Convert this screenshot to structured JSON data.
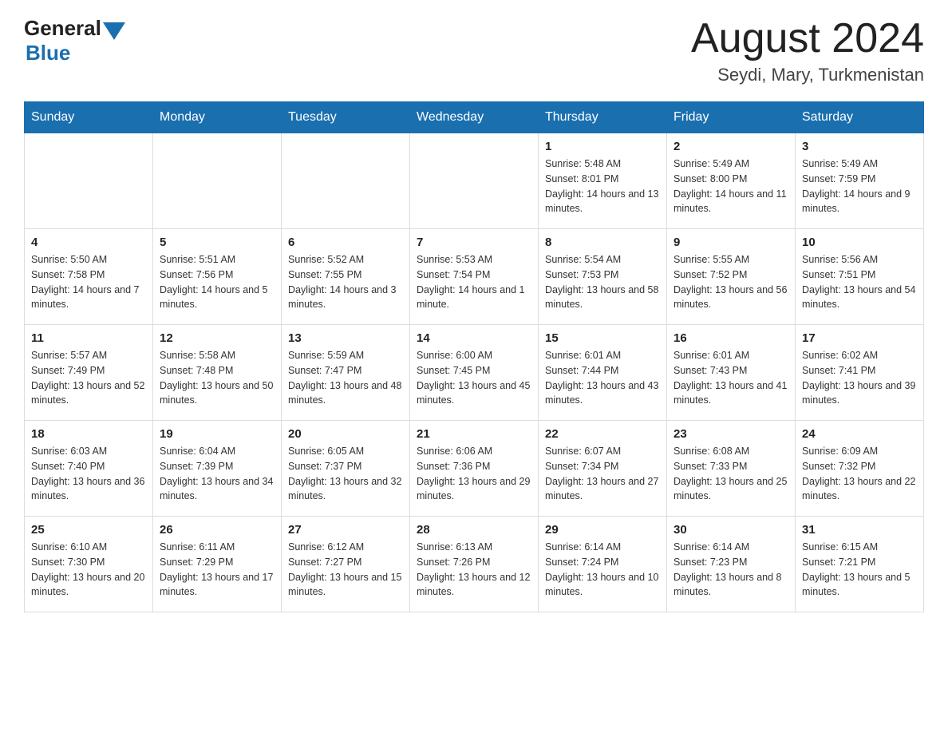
{
  "header": {
    "logo_general": "General",
    "logo_blue": "Blue",
    "title": "August 2024",
    "subtitle": "Seydi, Mary, Turkmenistan"
  },
  "weekdays": [
    "Sunday",
    "Monday",
    "Tuesday",
    "Wednesday",
    "Thursday",
    "Friday",
    "Saturday"
  ],
  "weeks": [
    [
      {
        "day": "",
        "info": ""
      },
      {
        "day": "",
        "info": ""
      },
      {
        "day": "",
        "info": ""
      },
      {
        "day": "",
        "info": ""
      },
      {
        "day": "1",
        "info": "Sunrise: 5:48 AM\nSunset: 8:01 PM\nDaylight: 14 hours and 13 minutes."
      },
      {
        "day": "2",
        "info": "Sunrise: 5:49 AM\nSunset: 8:00 PM\nDaylight: 14 hours and 11 minutes."
      },
      {
        "day": "3",
        "info": "Sunrise: 5:49 AM\nSunset: 7:59 PM\nDaylight: 14 hours and 9 minutes."
      }
    ],
    [
      {
        "day": "4",
        "info": "Sunrise: 5:50 AM\nSunset: 7:58 PM\nDaylight: 14 hours and 7 minutes."
      },
      {
        "day": "5",
        "info": "Sunrise: 5:51 AM\nSunset: 7:56 PM\nDaylight: 14 hours and 5 minutes."
      },
      {
        "day": "6",
        "info": "Sunrise: 5:52 AM\nSunset: 7:55 PM\nDaylight: 14 hours and 3 minutes."
      },
      {
        "day": "7",
        "info": "Sunrise: 5:53 AM\nSunset: 7:54 PM\nDaylight: 14 hours and 1 minute."
      },
      {
        "day": "8",
        "info": "Sunrise: 5:54 AM\nSunset: 7:53 PM\nDaylight: 13 hours and 58 minutes."
      },
      {
        "day": "9",
        "info": "Sunrise: 5:55 AM\nSunset: 7:52 PM\nDaylight: 13 hours and 56 minutes."
      },
      {
        "day": "10",
        "info": "Sunrise: 5:56 AM\nSunset: 7:51 PM\nDaylight: 13 hours and 54 minutes."
      }
    ],
    [
      {
        "day": "11",
        "info": "Sunrise: 5:57 AM\nSunset: 7:49 PM\nDaylight: 13 hours and 52 minutes."
      },
      {
        "day": "12",
        "info": "Sunrise: 5:58 AM\nSunset: 7:48 PM\nDaylight: 13 hours and 50 minutes."
      },
      {
        "day": "13",
        "info": "Sunrise: 5:59 AM\nSunset: 7:47 PM\nDaylight: 13 hours and 48 minutes."
      },
      {
        "day": "14",
        "info": "Sunrise: 6:00 AM\nSunset: 7:45 PM\nDaylight: 13 hours and 45 minutes."
      },
      {
        "day": "15",
        "info": "Sunrise: 6:01 AM\nSunset: 7:44 PM\nDaylight: 13 hours and 43 minutes."
      },
      {
        "day": "16",
        "info": "Sunrise: 6:01 AM\nSunset: 7:43 PM\nDaylight: 13 hours and 41 minutes."
      },
      {
        "day": "17",
        "info": "Sunrise: 6:02 AM\nSunset: 7:41 PM\nDaylight: 13 hours and 39 minutes."
      }
    ],
    [
      {
        "day": "18",
        "info": "Sunrise: 6:03 AM\nSunset: 7:40 PM\nDaylight: 13 hours and 36 minutes."
      },
      {
        "day": "19",
        "info": "Sunrise: 6:04 AM\nSunset: 7:39 PM\nDaylight: 13 hours and 34 minutes."
      },
      {
        "day": "20",
        "info": "Sunrise: 6:05 AM\nSunset: 7:37 PM\nDaylight: 13 hours and 32 minutes."
      },
      {
        "day": "21",
        "info": "Sunrise: 6:06 AM\nSunset: 7:36 PM\nDaylight: 13 hours and 29 minutes."
      },
      {
        "day": "22",
        "info": "Sunrise: 6:07 AM\nSunset: 7:34 PM\nDaylight: 13 hours and 27 minutes."
      },
      {
        "day": "23",
        "info": "Sunrise: 6:08 AM\nSunset: 7:33 PM\nDaylight: 13 hours and 25 minutes."
      },
      {
        "day": "24",
        "info": "Sunrise: 6:09 AM\nSunset: 7:32 PM\nDaylight: 13 hours and 22 minutes."
      }
    ],
    [
      {
        "day": "25",
        "info": "Sunrise: 6:10 AM\nSunset: 7:30 PM\nDaylight: 13 hours and 20 minutes."
      },
      {
        "day": "26",
        "info": "Sunrise: 6:11 AM\nSunset: 7:29 PM\nDaylight: 13 hours and 17 minutes."
      },
      {
        "day": "27",
        "info": "Sunrise: 6:12 AM\nSunset: 7:27 PM\nDaylight: 13 hours and 15 minutes."
      },
      {
        "day": "28",
        "info": "Sunrise: 6:13 AM\nSunset: 7:26 PM\nDaylight: 13 hours and 12 minutes."
      },
      {
        "day": "29",
        "info": "Sunrise: 6:14 AM\nSunset: 7:24 PM\nDaylight: 13 hours and 10 minutes."
      },
      {
        "day": "30",
        "info": "Sunrise: 6:14 AM\nSunset: 7:23 PM\nDaylight: 13 hours and 8 minutes."
      },
      {
        "day": "31",
        "info": "Sunrise: 6:15 AM\nSunset: 7:21 PM\nDaylight: 13 hours and 5 minutes."
      }
    ]
  ]
}
